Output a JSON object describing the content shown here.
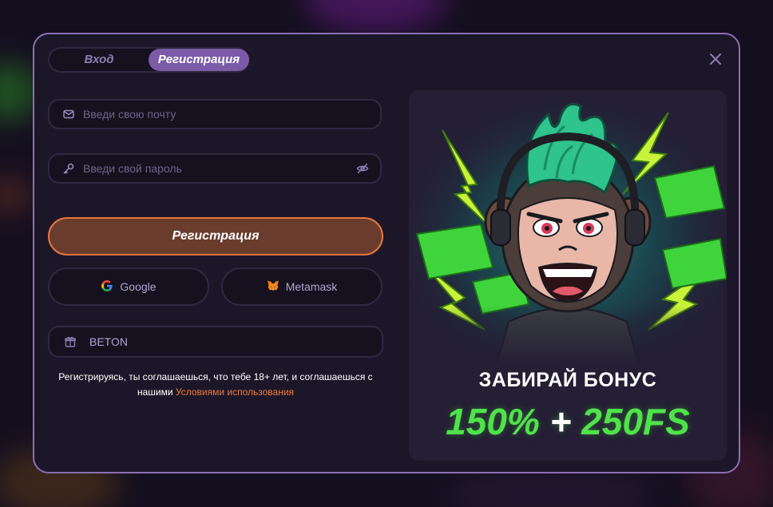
{
  "tabs": {
    "login_label": "Вход",
    "register_label": "Регистрация",
    "active": "register"
  },
  "close_icon": "close-icon",
  "form": {
    "email": {
      "placeholder": "Введи свою почту",
      "value": "",
      "icon": "envelope-icon"
    },
    "password": {
      "placeholder": "Введи свой пароль",
      "value": "",
      "icon": "key-icon",
      "toggle_icon": "eye-off-icon"
    },
    "submit_label": "Регистрация",
    "social": [
      {
        "label": "Google",
        "icon": "google-icon"
      },
      {
        "label": "Metamask",
        "icon": "metamask-fox-icon"
      }
    ],
    "promo": {
      "value": "BETON",
      "icon": "gift-icon"
    }
  },
  "terms": {
    "text": "Регистрируясь, ты соглашаешься, что тебе 18+ лет, и соглашаешься с нашими",
    "link_label": "Условиями использования"
  },
  "banner": {
    "title": "ЗАБИРАЙ БОНУС",
    "amount_left": "150%",
    "plus": "+",
    "amount_right": "250FS"
  },
  "colors": {
    "accent_purple": "#7b5ba8",
    "accent_orange": "#e8763f",
    "bonus_green": "#4fe34a",
    "panel_bg": "#1c1728"
  }
}
